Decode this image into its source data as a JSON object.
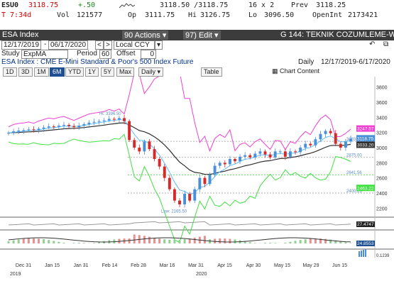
{
  "quote": {
    "ticker": "ESU0",
    "last": "3118.75",
    "change": "+.50",
    "bid_ask": "3118.50 /3118.75",
    "size": "16 x 2",
    "prev_label": "Prev",
    "prev": "3118.25",
    "time": "T  7:34d",
    "vol_label": "Vol",
    "vol": "121577",
    "op_label": "Op",
    "op": "3111.75",
    "hi_label": "Hi",
    "hi": "3126.75",
    "lo_label": "Lo",
    "lo": "3096.50",
    "oi_label": "OpenInt",
    "oi": "2173421"
  },
  "titlebar": {
    "security": "ESA Index",
    "actions": "90 Actions ▾",
    "edit": "97) Edit ▾",
    "page": "G 144: TEKNIK COZUMLEME-W1"
  },
  "datebar": {
    "start": "12/17/2019",
    "end": "06/17/2020",
    "currency": "Local CCY"
  },
  "study": {
    "label": "Study",
    "study_value": "ExpMA",
    "period_label": "Period",
    "period": "60",
    "offset_label": "Offset",
    "offset": "0"
  },
  "desc": {
    "text": "ESA Index : CME E-Mini Standard & Poor's 500 Index Future",
    "freq": "Daily",
    "range": "12/17/2019-6/17/2020"
  },
  "toolbar": {
    "periods": [
      "1D",
      "3D",
      "1M",
      "6M",
      "YTD",
      "1Y",
      "5Y",
      "Max"
    ],
    "active": "6M",
    "freq_select": "Daily ▾",
    "table": "Table",
    "chart_content": "Chart Content"
  },
  "colors": {
    "up_candle": "#4a90d9",
    "down_candle": "#d42a2a",
    "upper_band": "#f040d0",
    "lower_band": "#40e040",
    "ema": "#303030",
    "short_ma": "#60c0ff"
  },
  "chart_data": {
    "type": "candlestick",
    "title": "",
    "x_labels": [
      "Dec 31",
      "Jan 15",
      "Jan 31",
      "Feb 14",
      "Feb 28",
      "Mar 16",
      "Mar 31",
      "Apr 15",
      "Apr 30",
      "May 15",
      "May 29",
      "Jun 15"
    ],
    "year_labels": [
      "2019",
      "2020"
    ],
    "y_ticks": [
      2200,
      2400,
      2600,
      2800,
      3000,
      3200,
      3400,
      3600,
      3800
    ],
    "ylim": [
      2100,
      3900
    ],
    "annotations": {
      "high": "Hi: 3396.50",
      "low": "Low: 2165.50"
    },
    "fib_levels": [
      "3083.25",
      "2875.00",
      "2641.56",
      "2400.25"
    ],
    "right_tags": [
      {
        "label": "3247.57",
        "color": "#f040d0"
      },
      {
        "label": "3118.75",
        "color": "#4a90d9"
      },
      {
        "label": "3033.20",
        "color": "#303030"
      },
      {
        "label": "2463.22",
        "color": "#40e040"
      }
    ],
    "volume_tag": "27.4747",
    "indicator_tag": "24.8553",
    "bottom_tag": "0.1239",
    "closes": [
      3195,
      3215,
      3225,
      3230,
      3240,
      3230,
      3250,
      3265,
      3280,
      3275,
      3290,
      3300,
      3285,
      3270,
      3290,
      3310,
      3330,
      3340,
      3350,
      3360,
      3380,
      3370,
      3390,
      3350,
      3100,
      3000,
      2950,
      3080,
      2980,
      2850,
      2750,
      2600,
      2450,
      2300,
      2250,
      2390,
      2300,
      2450,
      2600,
      2520,
      2640,
      2760,
      2800,
      2780,
      2850,
      2820,
      2880,
      2900,
      2870,
      2920,
      2950,
      2910,
      2870,
      2950,
      2950,
      2880,
      2950,
      2940,
      3000,
      3050,
      3030,
      3110,
      3180,
      3220,
      3190,
      3050,
      3000,
      3080,
      3118.75
    ]
  }
}
